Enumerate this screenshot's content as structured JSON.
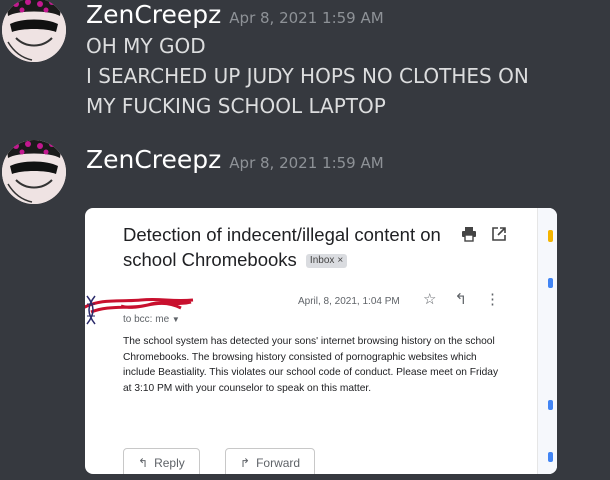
{
  "messages": [
    {
      "username": "ZenCreepz",
      "timestamp": "Apr 8, 2021 1:59 AM",
      "lines": [
        "OH MY GOD",
        "I SEARCHED UP JUDY HOPS NO CLOTHES ON",
        "MY FUCKING SCHOOL LAPTOP"
      ]
    },
    {
      "username": "ZenCreepz",
      "timestamp": "Apr 8, 2021 1:59 AM"
    }
  ],
  "email": {
    "subject": "Detection of indecent/illegal content on school Chromebooks",
    "badge": "Inbox",
    "badge_close": "×",
    "date": "April, 8, 2021, 1:04 PM",
    "to": "to bcc: me",
    "body": "The school system has detected your sons' internet browsing history on the school Chromebooks. The browsing history consisted of pornographic websites which include Beastiality. This violates our school code of conduct. Please meet on Friday at 3:10 PM with your counselor to speak on this matter.",
    "reply_label": "Reply",
    "forward_label": "Forward",
    "icons": {
      "print": "printer-icon",
      "open": "open-in-new-icon",
      "star": "star-icon",
      "reply": "reply-icon",
      "more": "more-vert-icon",
      "forward": "forward-icon",
      "dropdown": "chevron-down-icon"
    }
  },
  "colors": {
    "background": "#36393f",
    "username": "#ffffff",
    "timestamp": "#8e9297",
    "message_text": "#dcddde",
    "scribble": "#c8102e"
  }
}
